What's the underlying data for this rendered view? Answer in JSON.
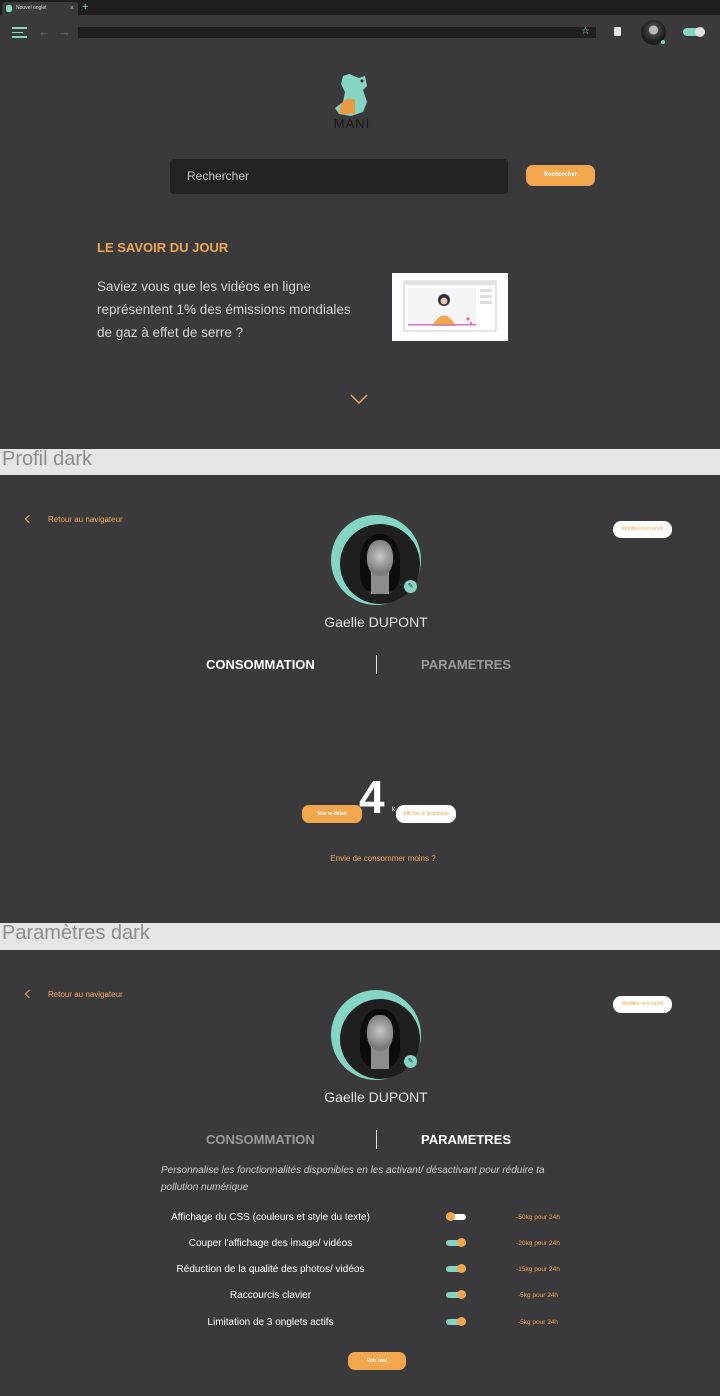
{
  "browser": {
    "tab_title": "Nouvel onglet",
    "tab_close": "×",
    "new_tab": "+",
    "logo_text": "MANI",
    "search_placeholder": "Rechercher",
    "search_button": "Rechercher",
    "fact_title": "LE SAVOIR DU JOUR",
    "fact_text": "Saviez vous que les vidéos en ligne représentent 1% des émissions mondiales  de gaz à effet de serre ?",
    "accent_color": "#84d6c3",
    "orange_color": "#f2a74f"
  },
  "sections": {
    "profile_label": "Profil dark",
    "settings_label": "Paramètres dark"
  },
  "profile": {
    "back_label": "Retour au navigateur",
    "modify_button": "Modifier mon profil",
    "name": "Gaelle DUPONT",
    "tab_consumption": "CONSOMMATION",
    "tab_settings": "PARAMETRES",
    "consumed_value": "4",
    "consumed_unit": "k",
    "detail_button": "Voir le détail",
    "graph_button": "Afficher le graphique",
    "consume_less": "Envie de consommer moins ?"
  },
  "settings": {
    "intro": "Personnalise les fonctionnalités disponibles en les activant/ désactivant pour réduire ta pollution numérique",
    "items": [
      {
        "label": "Affichage du CSS (couleurs et style du texte)",
        "saving": "-50kg pour 24h",
        "enabled": false
      },
      {
        "label": "Couper l'affichage des image/ vidéos",
        "saving": "-20kg pour 24h",
        "enabled": true
      },
      {
        "label": "Réduction de la qualité des photos/ vidéos",
        "saving": "-15kg pour 24h",
        "enabled": true
      },
      {
        "label": "Raccourcis clavier",
        "saving": "-5kg pour 24h",
        "enabled": true
      },
      {
        "label": "Limitation de 3 onglets actifs",
        "saving": "-5kg pour 24h",
        "enabled": true
      }
    ],
    "see_all_button": "Voir tout"
  }
}
